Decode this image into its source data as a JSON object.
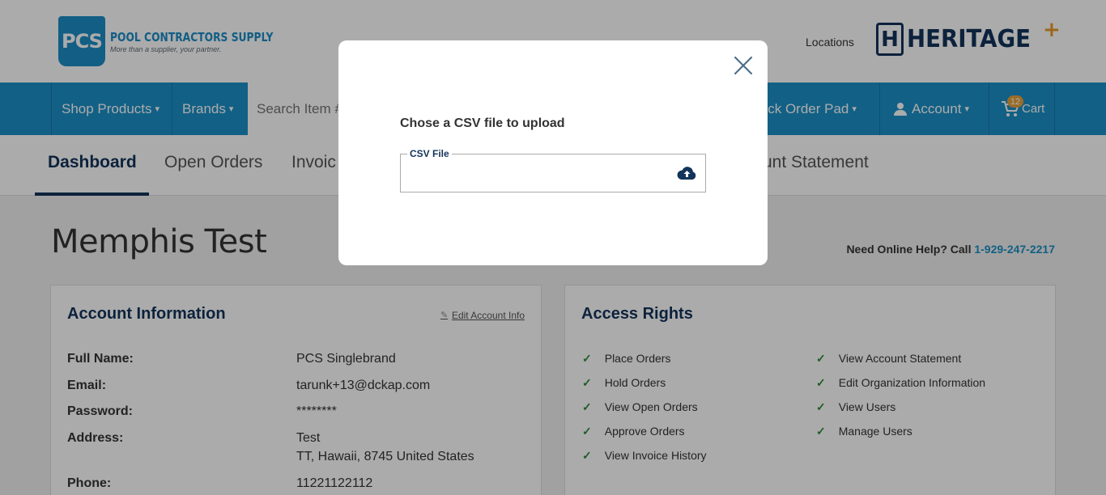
{
  "header": {
    "logo_abbr": "PCS",
    "logo_name": "POOL CONTRACTORS SUPPLY",
    "logo_tagline": "More than a supplier, your partner.",
    "locations_label": "Locations",
    "heritage_letter": "H",
    "heritage_word": "HERITAGE",
    "heritage_plus": "+"
  },
  "nav": {
    "shop_products": "Shop Products",
    "brands": "Brands",
    "search_placeholder": "Search Item #",
    "quick_order_pad": "uick Order Pad",
    "account": "Account",
    "cart": "Cart",
    "cart_count": "12",
    "caret": "⌄"
  },
  "tabs": {
    "dashboard": "Dashboard",
    "open_orders": "Open Orders",
    "invoice": "Invoic",
    "account_statement": "unt Statement"
  },
  "main": {
    "title": "Memphis Test",
    "help_text": "Need Online Help? Call ",
    "help_phone": "1-929-247-2217"
  },
  "account_info": {
    "title": "Account Information",
    "edit_link": "Edit Account Info",
    "rows": [
      {
        "label": "Full Name:",
        "value": "PCS Singlebrand"
      },
      {
        "label": "Email:",
        "value": "tarunk+13@dckap.com"
      },
      {
        "label": "Password:",
        "value": "********"
      },
      {
        "label": "Address:",
        "value": "Test",
        "value2": "TT, Hawaii, 8745 United States"
      },
      {
        "label": "Phone:",
        "value": "11221122112"
      }
    ]
  },
  "access_rights": {
    "title": "Access Rights",
    "left": [
      "Place Orders",
      "Hold Orders",
      "View Open Orders",
      "Approve Orders",
      "View Invoice History"
    ],
    "right": [
      "View Account Statement",
      "Edit Organization Information",
      "View Users",
      "Manage Users"
    ],
    "check": "✓"
  },
  "modal": {
    "title": "Chose a CSV file to upload",
    "field_label": "CSV File"
  },
  "colors": {
    "nav_blue": "#1c8fc7",
    "navy": "#13345a",
    "cart_badge": "#e8a23b",
    "check_green": "#2e8b3a"
  }
}
